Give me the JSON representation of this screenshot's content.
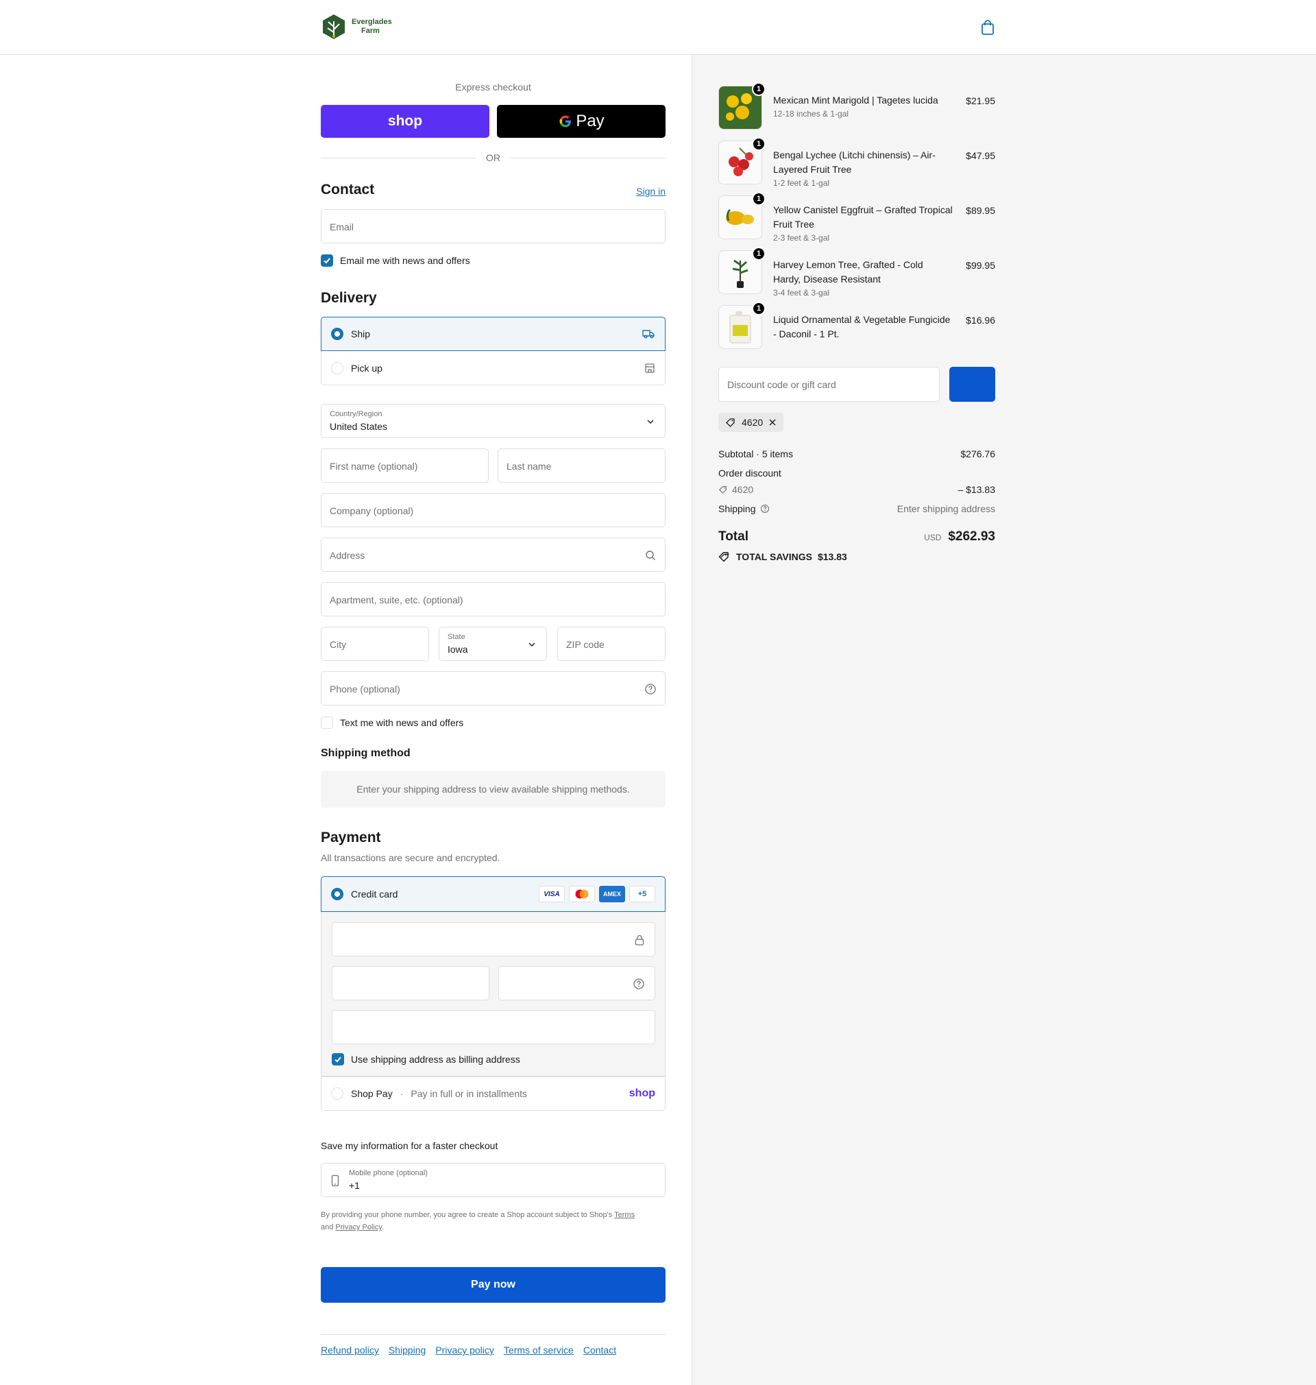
{
  "header": {
    "brand_line1": "Everglades",
    "brand_line2": "Farm",
    "brand_color": "#2d5c2e"
  },
  "express": {
    "label": "Express checkout",
    "shop_label": "shop",
    "gpay_label": "Pay",
    "or_label": "OR"
  },
  "contact": {
    "title": "Contact",
    "sign_in": "Sign in",
    "email_placeholder": "Email",
    "email_offers_label": "Email me with news and offers",
    "email_offers_checked": true
  },
  "delivery": {
    "title": "Delivery",
    "options": [
      {
        "label": "Ship",
        "selected": true,
        "icon": "truck-icon"
      },
      {
        "label": "Pick up",
        "selected": false,
        "icon": "store-icon"
      }
    ],
    "country_label": "Country/Region",
    "country_value": "United States",
    "first_name_placeholder": "First name (optional)",
    "last_name_placeholder": "Last name",
    "company_placeholder": "Company (optional)",
    "address_placeholder": "Address",
    "apartment_placeholder": "Apartment, suite, etc. (optional)",
    "city_placeholder": "City",
    "state_label": "State",
    "state_value": "Iowa",
    "zip_placeholder": "ZIP code",
    "phone_placeholder": "Phone (optional)",
    "text_offers_label": "Text me with news and offers",
    "text_offers_checked": false
  },
  "shipping_method": {
    "title": "Shipping method",
    "note": "Enter your shipping address to view available shipping methods."
  },
  "payment": {
    "title": "Payment",
    "subtitle": "All transactions are secure and encrypted.",
    "credit_card_label": "Credit card",
    "card_brands": [
      "VISA",
      "Mastercard",
      "AMEX",
      "+5"
    ],
    "billing_same_label": "Use shipping address as billing address",
    "billing_same_checked": true,
    "shop_pay_label": "Shop Pay",
    "shop_pay_sub": "Pay in full or in installments",
    "shop_pay_logo": "shop"
  },
  "save_info": {
    "title": "Save my information for a faster checkout",
    "mobile_label": "Mobile phone (optional)",
    "mobile_value": "+1",
    "disclaimer_pre": "By providing your phone number, you agree to create a Shop account subject to Shop's ",
    "terms_link": "Terms",
    "disclaimer_mid": "and ",
    "privacy_link": "Privacy Policy",
    "disclaimer_end": "."
  },
  "pay_now": "Pay now",
  "footer_links": [
    "Refund policy",
    "Shipping",
    "Privacy policy",
    "Terms of service",
    "Contact"
  ],
  "summary": {
    "items": [
      {
        "name": "Mexican Mint Marigold | Tagetes lucida",
        "variant": "12-18 inches & 1-gal",
        "price": "$21.95",
        "qty": "1"
      },
      {
        "name": "Bengal Lychee (Litchi chinensis) – Air-Layered Fruit Tree",
        "variant": "1-2 feet & 1-gal",
        "price": "$47.95",
        "qty": "1"
      },
      {
        "name": "Yellow Canistel Eggfruit – Grafted Tropical Fruit Tree",
        "variant": "2-3 feet & 3-gal",
        "price": "$89.95",
        "qty": "1"
      },
      {
        "name": "Harvey Lemon Tree, Grafted - Cold Hardy, Disease Resistant",
        "variant": "3-4 feet & 3-gal",
        "price": "$99.95",
        "qty": "1"
      },
      {
        "name": "Liquid Ornamental & Vegetable Fungicide - Daconil - 1 Pt.",
        "variant": "",
        "price": "$16.96",
        "qty": "1"
      }
    ],
    "discount_placeholder": "Discount code or gift card",
    "applied_code": "4620",
    "subtotal_label": "Subtotal · 5 items",
    "subtotal_value": "$276.76",
    "order_discount_label": "Order discount",
    "discount_code": "4620",
    "discount_value": "– $13.83",
    "shipping_label": "Shipping",
    "shipping_value": "Enter shipping address",
    "total_label": "Total",
    "currency": "USD",
    "total_value": "$262.93",
    "savings_label": "TOTAL SAVINGS",
    "savings_value": "$13.83"
  },
  "colors": {
    "accent": "#1773b0",
    "primary_button": "#0b57d0",
    "shop_purple": "#5a31f4"
  }
}
